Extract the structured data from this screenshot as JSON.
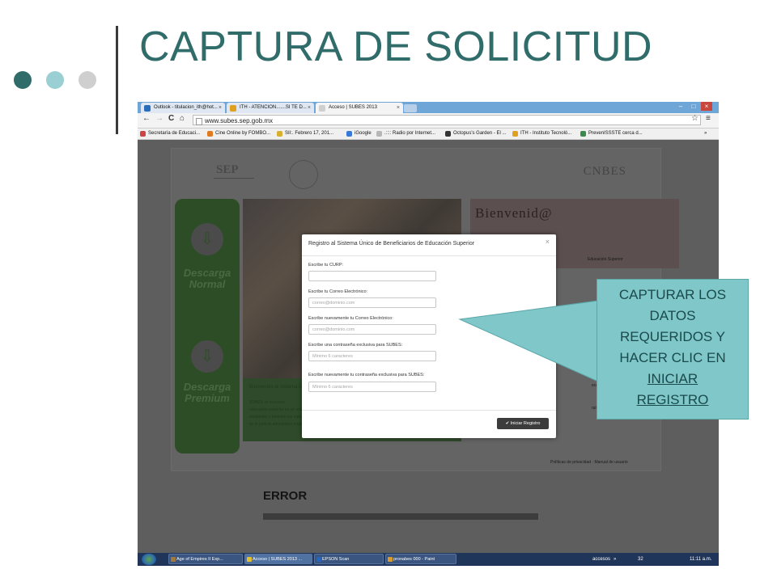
{
  "slide": {
    "title": "CAPTURA DE SOLICITUD",
    "dot_colors": [
      "#2f6c6a",
      "#9acfd3",
      "#cfcfcf"
    ]
  },
  "browser": {
    "tabs": [
      {
        "label": "Outlook - titulacion_ith@hot...",
        "close": "×"
      },
      {
        "label": "ITH - ATENCION.......SI TE D...",
        "close": "×"
      },
      {
        "label": "Acceso | SUBES 2013",
        "close": "×"
      }
    ],
    "window_controls": [
      "–",
      "□",
      "×"
    ],
    "nav": {
      "back": "←",
      "forward": "→",
      "reload": "C",
      "home": "⌂"
    },
    "url": "www.subes.sep.gob.mx",
    "star": "☆",
    "menu": "≡",
    "bookmarks": [
      "Secretaría de Educaci...",
      "Cine Online by FOMBO...",
      "SII:. Febrero 17, 201...",
      "iGoogle",
      ".:::: Radio por Internet...",
      "Octopus's Garden - El ...",
      "ITH - Instituto Tecnoló...",
      "PrevenISSSTE cerca d..."
    ],
    "bookmarks_more": "»"
  },
  "site": {
    "sep_logo": "SEP",
    "cnbes_logo": "CNBES",
    "download_normal": [
      "Descarga",
      "Normal"
    ],
    "download_premium": [
      "Descarga",
      "Premium"
    ],
    "welcome_heading": "Bienvenid@",
    "subes_tag": "Educación Superior",
    "photo_caption": "Bienvenido al Sistema Únic",
    "photo_text": [
      "SUBES es el nuevo",
      "educación superior en un solo",
      "existentes y también los nuevo",
      "se lo podrás administrar mejor"
    ],
    "side_fragment_1": "era tu contra",
    "side_fragment_2": "ral",
    "footer_links": "Políticas de privacidad · Manual de usuario",
    "error_heading": "ERROR"
  },
  "modal": {
    "title": "Registro al Sistema Único de Beneficiarios de Educación Superior",
    "close": "×",
    "fields": [
      {
        "label": "Escribe tu CURP:",
        "placeholder": ""
      },
      {
        "label": "Escribe tu Correo Electrónico:",
        "placeholder": "correo@dominio.com"
      },
      {
        "label": "Escribe nuevamente tu Correo Electrónico:",
        "placeholder": "correo@dominio.com"
      },
      {
        "label": "Escribe una contraseña exclusiva para SUBES:",
        "placeholder": "Mínimo 6 caracteres"
      },
      {
        "label": "Escribe nuevamente tu contraseña exclusiva para SUBES:",
        "placeholder": "Mínimo 6 caracteres"
      }
    ],
    "submit_label": "Iniciar Registro"
  },
  "taskbar": {
    "tasks": [
      "Age of Empires II Exp...",
      "Acceso | SUBES 2013 ...",
      "EPSON Scan",
      "pronabes 000 - Paint"
    ],
    "tray_label": "accesos",
    "tray_count": "32",
    "clock": "11:11 a.m."
  },
  "callout": {
    "text_lines": [
      "CAPTURAR LOS",
      "DATOS",
      "REQUERIDOS Y",
      "HACER CLIC EN"
    ],
    "link_lines": [
      "INICIAR",
      "REGISTRO"
    ],
    "color": "#7fc7c9"
  }
}
